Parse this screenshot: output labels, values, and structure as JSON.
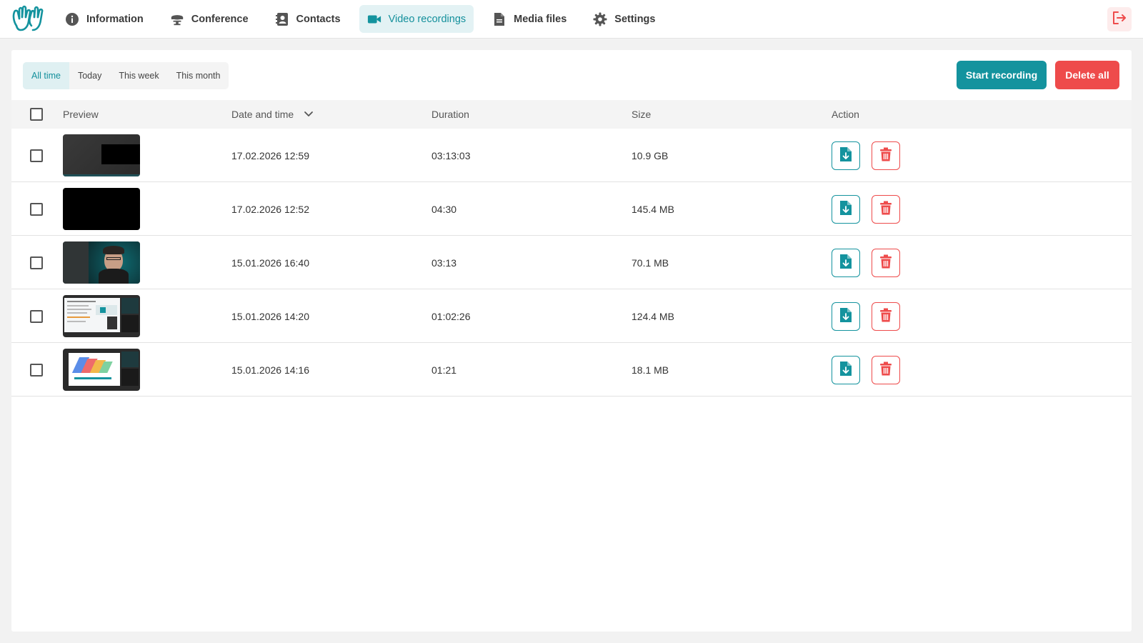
{
  "nav": {
    "items": [
      {
        "label": "Information",
        "icon": "info-icon"
      },
      {
        "label": "Conference",
        "icon": "conference-icon"
      },
      {
        "label": "Contacts",
        "icon": "contacts-icon"
      },
      {
        "label": "Video recordings",
        "icon": "video-camera-icon"
      },
      {
        "label": "Media files",
        "icon": "document-icon"
      },
      {
        "label": "Settings",
        "icon": "gear-icon"
      }
    ],
    "active": "Video recordings"
  },
  "filters": {
    "items": [
      "All time",
      "Today",
      "This week",
      "This month"
    ],
    "active": "All time"
  },
  "toolbar": {
    "start_label": "Start recording",
    "delete_all_label": "Delete all"
  },
  "table": {
    "headers": {
      "preview": "Preview",
      "date": "Date and time",
      "duration": "Duration",
      "size": "Size",
      "action": "Action"
    },
    "rows": [
      {
        "date": "17.02.2026 12:59",
        "duration": "03:13:03",
        "size": "10.9 GB",
        "thumb": "dark-screen"
      },
      {
        "date": "17.02.2026 12:52",
        "duration": "04:30",
        "size": "145.4 MB",
        "thumb": "black"
      },
      {
        "date": "15.01.2026 16:40",
        "duration": "03:13",
        "size": "70.1 MB",
        "thumb": "webcam-person"
      },
      {
        "date": "15.01.2026 14:20",
        "duration": "01:02:26",
        "size": "124.4 MB",
        "thumb": "document-share"
      },
      {
        "date": "15.01.2026 14:16",
        "duration": "01:21",
        "size": "18.1 MB",
        "thumb": "presentation-share"
      }
    ]
  },
  "colors": {
    "accent": "#14939e",
    "danger": "#ee4b4b"
  }
}
